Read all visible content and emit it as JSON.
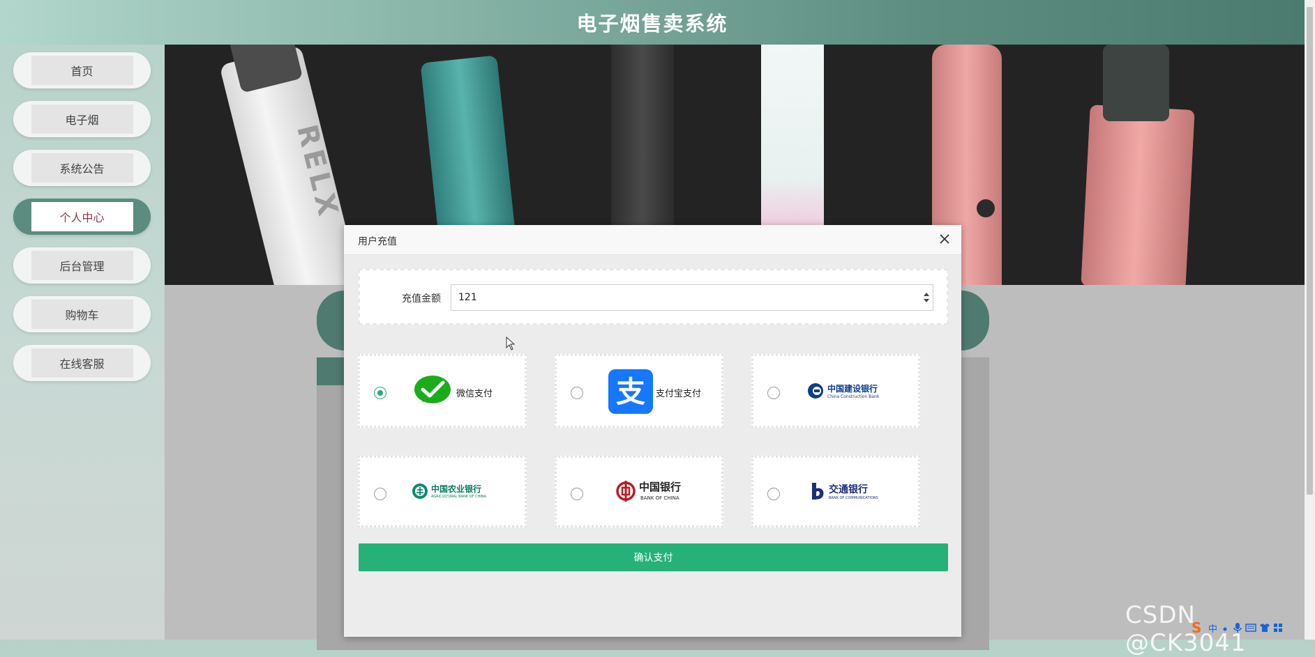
{
  "header": {
    "title": "电子烟售卖系统"
  },
  "sidebar": {
    "items": [
      {
        "label": "首页"
      },
      {
        "label": "电子烟"
      },
      {
        "label": "系统公告"
      },
      {
        "label": "个人中心"
      },
      {
        "label": "后台管理"
      },
      {
        "label": "购物车"
      },
      {
        "label": "在线客服"
      }
    ],
    "active_index": 3
  },
  "dialog": {
    "title": "用户充值",
    "amount_label": "充值金额",
    "amount_value": "121",
    "payment_methods": [
      {
        "id": "wechat",
        "label": "微信支付",
        "selected": true
      },
      {
        "id": "alipay",
        "label": "支付宝支付",
        "selected": false
      },
      {
        "id": "ccb",
        "label": "中国建设银行",
        "sub": "China Construction Bank",
        "selected": false
      },
      {
        "id": "abc",
        "label": "中国农业银行",
        "sub": "AGRICULTURAL BANK OF CHINA",
        "selected": false
      },
      {
        "id": "boc",
        "label": "中国银行",
        "sub": "BANK OF CHINA",
        "selected": false
      },
      {
        "id": "bocom",
        "label": "交通银行",
        "sub": "BANK OF COMMUNICATIONS",
        "selected": false
      }
    ],
    "confirm_label": "确认支付"
  },
  "banner": {
    "brand_text": "RELX"
  },
  "watermark": "CSDN @CK3041",
  "ime": {
    "lang": "中"
  },
  "colors": {
    "accent": "#26b178",
    "nav_active": "#5b8c7f",
    "active_text": "#8b3a4a"
  }
}
